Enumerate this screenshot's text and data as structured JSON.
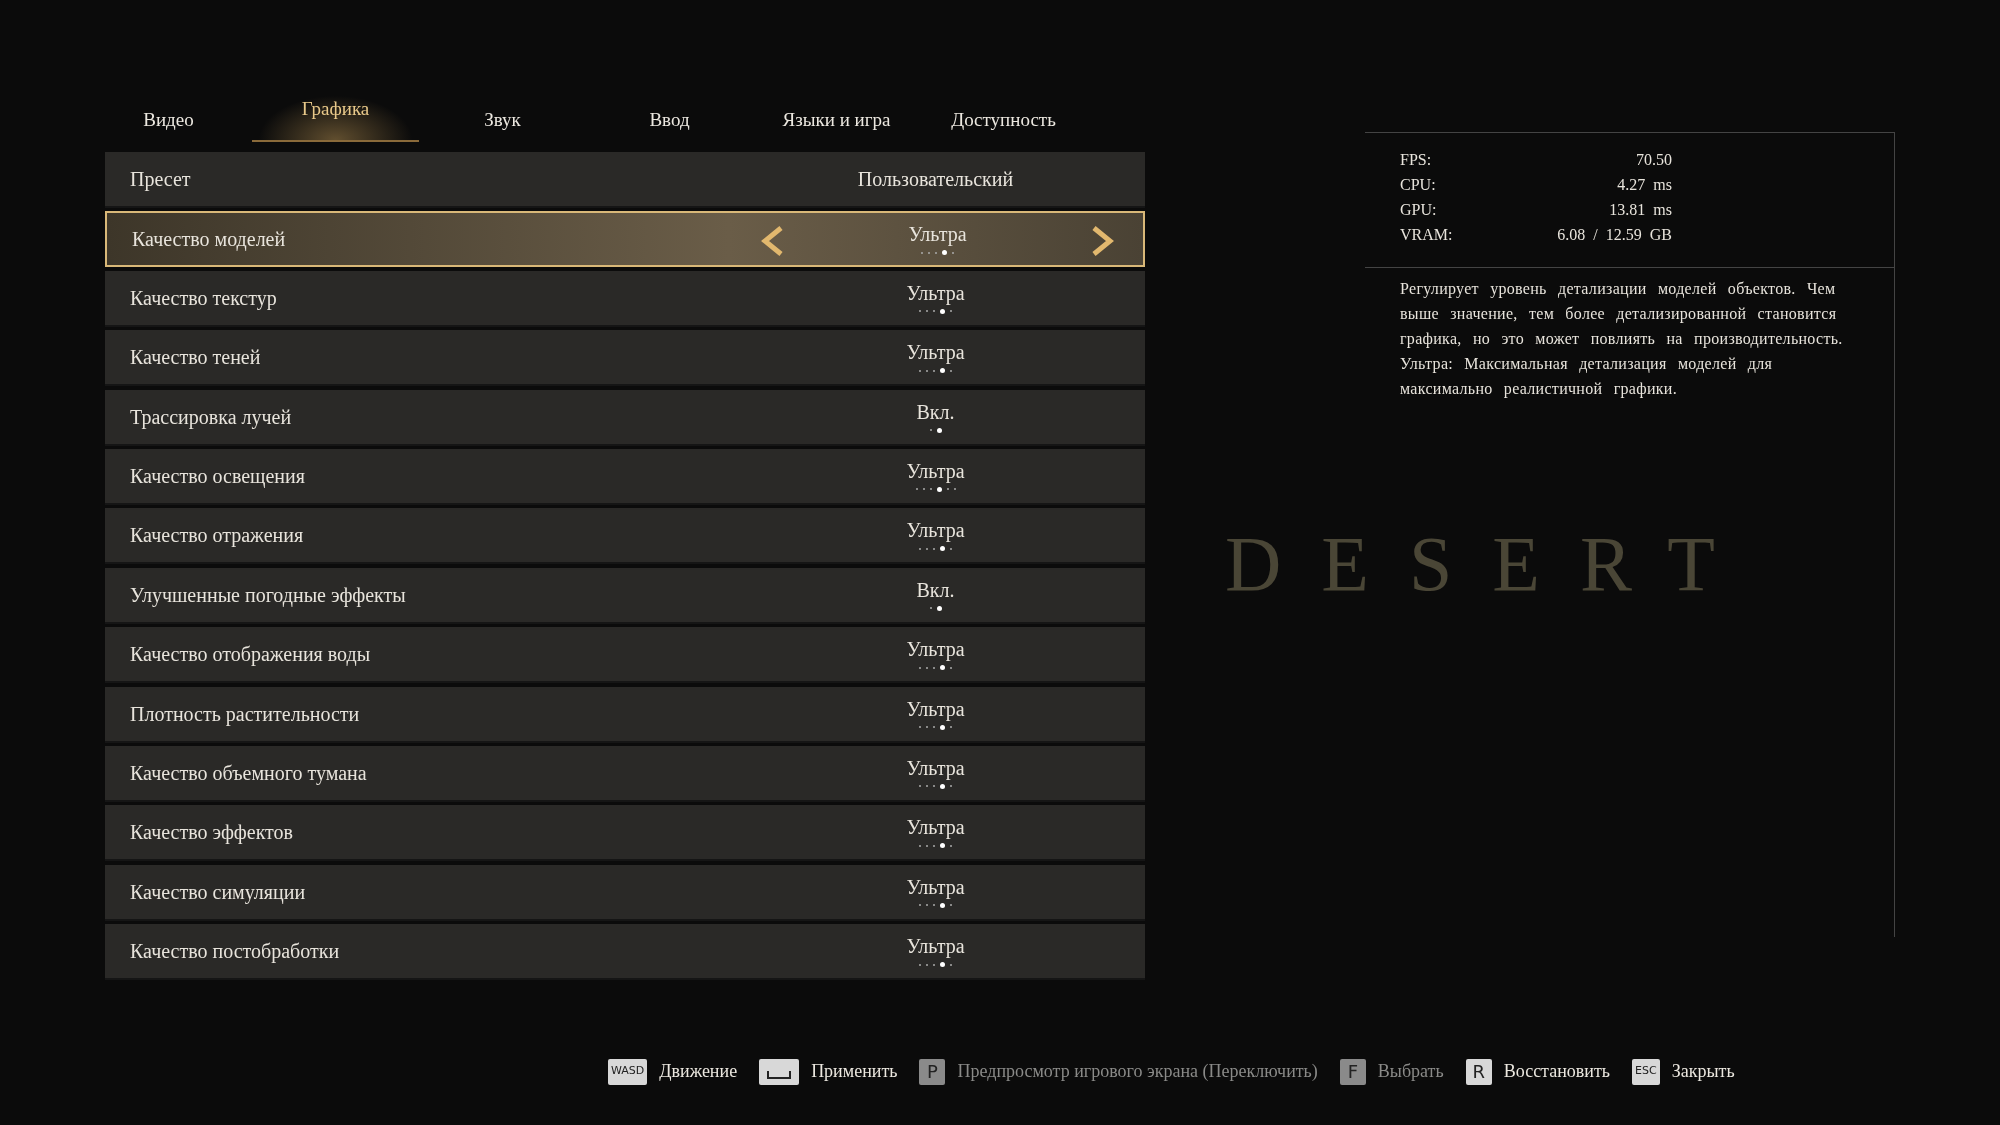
{
  "tabs": [
    {
      "label": "Видео",
      "selected": false
    },
    {
      "label": "Графика",
      "selected": true
    },
    {
      "label": "Звук",
      "selected": false
    },
    {
      "label": "Ввод",
      "selected": false
    },
    {
      "label": "Языки и игра",
      "selected": false
    },
    {
      "label": "Доступность",
      "selected": false
    }
  ],
  "settings": [
    {
      "kind": "text",
      "label": "Пресет",
      "value": "Пользовательский",
      "selected": false
    },
    {
      "kind": "choice",
      "label": "Качество моделей",
      "value": "Ультра",
      "selected": true,
      "steps": [
        {
          "selected": false
        },
        {
          "selected": false
        },
        {
          "selected": false
        },
        {
          "selected": true
        },
        {
          "selected": false
        }
      ]
    },
    {
      "kind": "choice",
      "label": "Качество текстур",
      "value": "Ультра",
      "selected": false,
      "steps": [
        {
          "selected": false
        },
        {
          "selected": false
        },
        {
          "selected": false
        },
        {
          "selected": true
        },
        {
          "selected": false
        }
      ]
    },
    {
      "kind": "choice",
      "label": "Качество теней",
      "value": "Ультра",
      "selected": false,
      "steps": [
        {
          "selected": false
        },
        {
          "selected": false
        },
        {
          "selected": false
        },
        {
          "selected": true
        },
        {
          "selected": false
        }
      ]
    },
    {
      "kind": "choice",
      "label": "Трассировка лучей",
      "value": "Вкл.",
      "selected": false,
      "steps": [
        {
          "selected": false
        },
        {
          "selected": true
        }
      ]
    },
    {
      "kind": "choice",
      "label": "Качество освещения",
      "value": "Ультра",
      "selected": false,
      "steps": [
        {
          "selected": false
        },
        {
          "selected": false
        },
        {
          "selected": false
        },
        {
          "selected": true
        },
        {
          "selected": false
        },
        {
          "selected": false
        }
      ]
    },
    {
      "kind": "choice",
      "label": "Качество отражения",
      "value": "Ультра",
      "selected": false,
      "steps": [
        {
          "selected": false
        },
        {
          "selected": false
        },
        {
          "selected": false
        },
        {
          "selected": true
        },
        {
          "selected": false
        }
      ]
    },
    {
      "kind": "choice",
      "label": "Улучшенные погодные эффекты",
      "value": "Вкл.",
      "selected": false,
      "steps": [
        {
          "selected": false
        },
        {
          "selected": true
        }
      ]
    },
    {
      "kind": "choice",
      "label": "Качество отображения воды",
      "value": "Ультра",
      "selected": false,
      "steps": [
        {
          "selected": false
        },
        {
          "selected": false
        },
        {
          "selected": false
        },
        {
          "selected": true
        },
        {
          "selected": false
        }
      ]
    },
    {
      "kind": "choice",
      "label": "Плотность растительности",
      "value": "Ультра",
      "selected": false,
      "steps": [
        {
          "selected": false
        },
        {
          "selected": false
        },
        {
          "selected": false
        },
        {
          "selected": true
        },
        {
          "selected": false
        }
      ]
    },
    {
      "kind": "choice",
      "label": "Качество объемного тумана",
      "value": "Ультра",
      "selected": false,
      "steps": [
        {
          "selected": false
        },
        {
          "selected": false
        },
        {
          "selected": false
        },
        {
          "selected": true
        },
        {
          "selected": false
        }
      ]
    },
    {
      "kind": "choice",
      "label": "Качество эффектов",
      "value": "Ультра",
      "selected": false,
      "steps": [
        {
          "selected": false
        },
        {
          "selected": false
        },
        {
          "selected": false
        },
        {
          "selected": true
        },
        {
          "selected": false
        }
      ]
    },
    {
      "kind": "choice",
      "label": "Качество симуляции",
      "value": "Ультра",
      "selected": false,
      "steps": [
        {
          "selected": false
        },
        {
          "selected": false
        },
        {
          "selected": false
        },
        {
          "selected": true
        },
        {
          "selected": false
        }
      ]
    },
    {
      "kind": "choice",
      "label": "Качество постобработки",
      "value": "Ультра",
      "selected": false,
      "steps": [
        {
          "selected": false
        },
        {
          "selected": false
        },
        {
          "selected": false
        },
        {
          "selected": true
        },
        {
          "selected": false
        }
      ]
    }
  ],
  "stats": [
    {
      "label": "FPS:",
      "value": "70.50"
    },
    {
      "label": "CPU:",
      "value": "4.27  ms"
    },
    {
      "label": "GPU:",
      "value": "13.81  ms"
    },
    {
      "label": "VRAM:",
      "value": "6.08  /  12.59  GB"
    }
  ],
  "description": [
    "Регулирует уровень детализации моделей объектов. Чем выше значение, тем более детализированной становится графика, но это может повлиять на производительность.",
    "Ультра: Максимальная детализация моделей для максимально реалистичной графики."
  ],
  "background_logo": "DESERT",
  "controls": [
    {
      "key": "WASD",
      "kind": "text",
      "label": "Движение",
      "disabled": false
    },
    {
      "kind": "space",
      "label": "Применить",
      "disabled": false
    },
    {
      "key": "P",
      "kind": "text",
      "label": "Предпросмотр игрового экрана (Переключить)",
      "disabled": true
    },
    {
      "key": "F",
      "kind": "text",
      "label": "Выбрать",
      "disabled": true
    },
    {
      "key": "R",
      "kind": "text",
      "label": "Восстановить",
      "disabled": false
    },
    {
      "key": "ESC",
      "kind": "text",
      "label": "Закрыть",
      "disabled": false
    }
  ]
}
